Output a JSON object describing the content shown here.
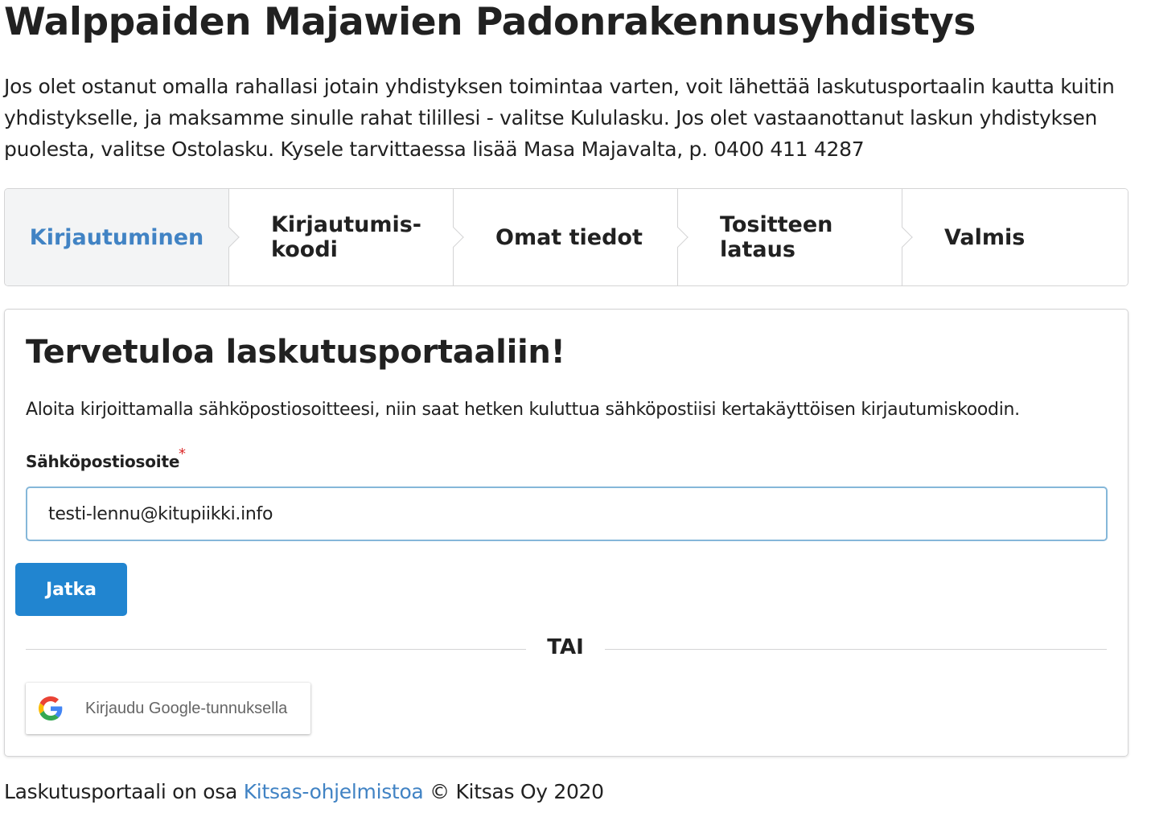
{
  "header": {
    "title": "Walppaiden Majawien Padonrakennusyhdistys",
    "intro": "Jos olet ostanut omalla rahallasi jotain yhdistyksen toimintaa varten, voit lähettää laskutusportaalin kautta kuitin yhdistykselle, ja maksamme sinulle rahat tilillesi - valitse Kululasku. Jos olet vastaanottanut laskun yhdistyksen puolesta, valitse Ostolasku. Kysele tarvittaessa lisää Masa Majavalta, p. 0400 411 4287"
  },
  "steps": [
    {
      "label": "Kirjautuminen",
      "active": true
    },
    {
      "label": "Kirjautumis-\nkoodi",
      "active": false
    },
    {
      "label": "Omat tiedot",
      "active": false
    },
    {
      "label": "Tositteen\nlataus",
      "active": false
    },
    {
      "label": "Valmis",
      "active": false
    }
  ],
  "login": {
    "title": "Tervetuloa laskutusportaaliin!",
    "description": "Aloita kirjoittamalla sähköpostiosoitteesi, niin saat hetken kuluttua sähköpostiisi kertakäyttöisen kirjautumiskoodin.",
    "email_label": "Sähköpostiosoite",
    "required_mark": "*",
    "email_value": "testi-lennu@kitupiikki.info",
    "continue_label": "Jatka",
    "divider_label": "TAI",
    "google_label": "Kirjaudu Google-tunnuksella"
  },
  "footer": {
    "prefix": "Laskutusportaali on osa ",
    "link_text": "Kitsas-ohjelmistoa",
    "suffix": " © Kitsas Oy 2020"
  },
  "colors": {
    "accent": "#2185d0",
    "link": "#4183c4",
    "required": "#db2828",
    "border": "#d4d4d5",
    "active_step_bg": "#f3f4f5"
  }
}
